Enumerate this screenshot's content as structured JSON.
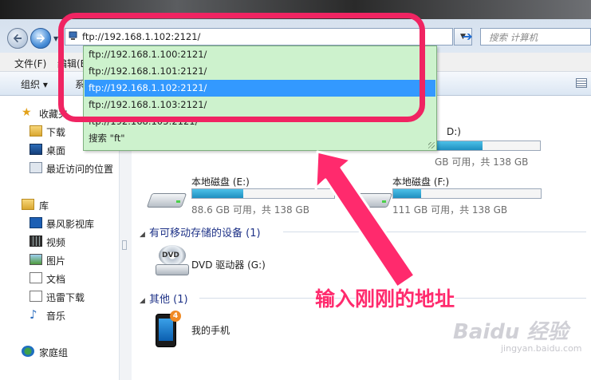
{
  "address_bar": {
    "value": "ftp://192.168.1.102:2121/"
  },
  "search": {
    "placeholder": "搜索 计算机"
  },
  "menu": {
    "file": "文件(F)",
    "edit": "编辑(E)"
  },
  "toolbar": {
    "organize": "组织",
    "system": "系"
  },
  "navigation": {
    "favorites": "收藏夹",
    "download": "下载",
    "desktop": "桌面",
    "recent": "最近访问的位置",
    "libraries": "库",
    "storm": "暴风影视库",
    "video": "视频",
    "pictures": "图片",
    "documents": "文档",
    "xunlei": "迅雷下载",
    "music": "音乐",
    "homegroup": "家庭组"
  },
  "dropdown": {
    "items": [
      "ftp://192.168.1.100:2121/",
      "ftp://192.168.1.101:2121/",
      "ftp://192.168.1.102:2121/",
      "ftp://192.168.1.103:2121/",
      "ftp://192.168.103:2121/"
    ],
    "selected_index": 2,
    "search_item": "搜索 \"ft\""
  },
  "drives": {
    "d_label_tail": "D:)",
    "d_free": "GB 可用，共 138 GB",
    "d_fill": 0.45,
    "e": {
      "name": "本地磁盘 (E:)",
      "free": "88.6 GB 可用，共 138 GB",
      "fill": 0.36
    },
    "f": {
      "name": "本地磁盘 (F:)",
      "free": "111 GB 可用，共 138 GB",
      "fill": 0.19
    }
  },
  "sections": {
    "removable": "有可移动存储的设备 (1)",
    "other": "其他 (1)"
  },
  "dvd": {
    "name": "DVD 驱动器 (G:)",
    "badge": "DVD"
  },
  "phone": {
    "name": "我的手机",
    "badge": "4"
  },
  "annotation": {
    "text": "输入刚刚的地址"
  },
  "watermark": {
    "logo": "Baidu 经验",
    "url": "jingyan.baidu.com"
  },
  "colors": {
    "annotation": "#ff2a6d",
    "dropdown_bg": "#cdf2cd",
    "selection": "#3399ff",
    "drive_fill": "#1f8fc0"
  }
}
